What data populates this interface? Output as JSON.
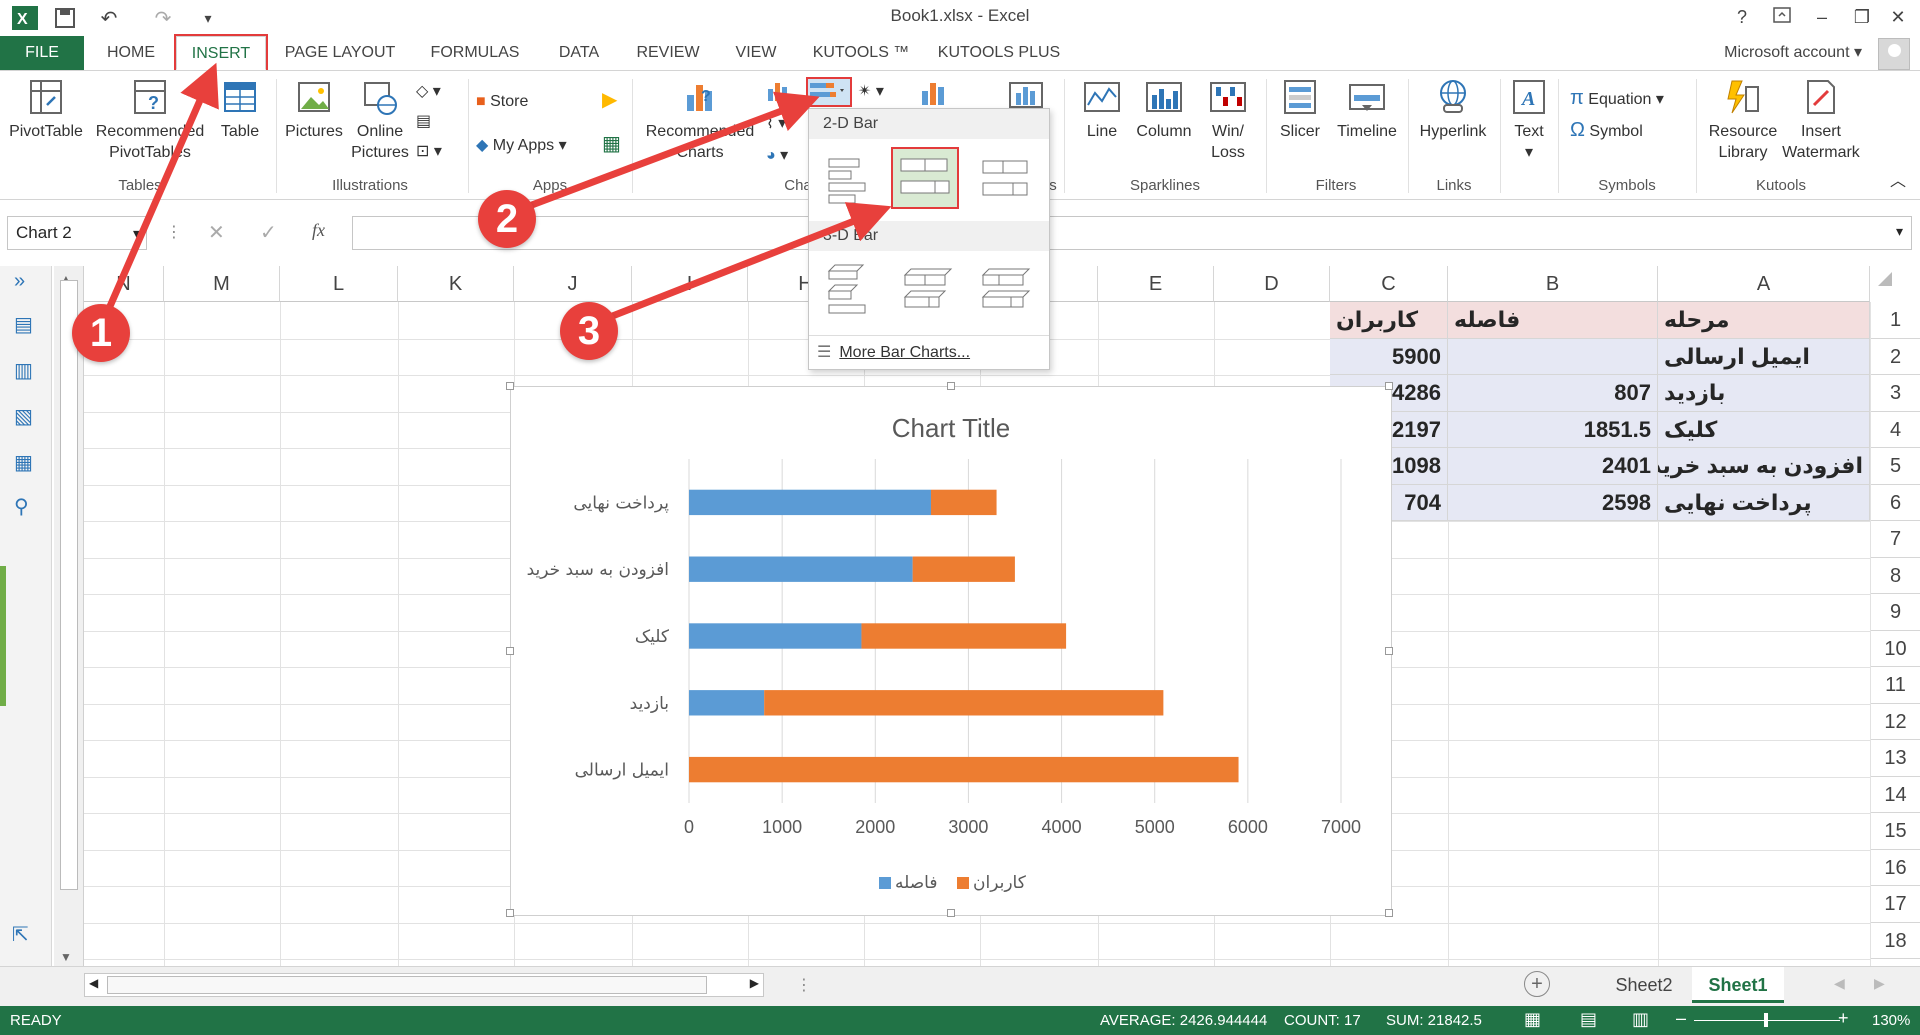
{
  "window": {
    "title": "Book1.xlsx - Excel",
    "help": "?",
    "quick_access": [
      "save-icon",
      "undo-icon",
      "redo-icon",
      "customize-icon"
    ]
  },
  "tabs": [
    "FILE",
    "HOME",
    "INSERT",
    "PAGE LAYOUT",
    "FORMULAS",
    "DATA",
    "REVIEW",
    "VIEW",
    "KUTOOLS ™",
    "KUTOOLS PLUS"
  ],
  "active_tab": "INSERT",
  "account": "Microsoft account",
  "ribbon": {
    "pivottable": "PivotTable",
    "recommended_pivot": [
      "Recommended",
      "PivotTables"
    ],
    "table": "Table",
    "pictures": "Pictures",
    "online_pictures": [
      "Online",
      "Pictures"
    ],
    "store": "Store",
    "my_apps": "My Apps",
    "recommended_charts": [
      "Recommended",
      "Charts"
    ],
    "line": "Line",
    "column": "Column",
    "winloss": [
      "Win/",
      "Loss"
    ],
    "slicer": "Slicer",
    "timeline": "Timeline",
    "hyperlink": "Hyperlink",
    "text": "Text",
    "equation": "Equation",
    "symbol": "Symbol",
    "resource_library": [
      "Resource",
      "Library"
    ],
    "insert_watermark": [
      "Insert",
      "Watermark"
    ],
    "groups": {
      "tables": "Tables",
      "illustrations": "Illustrations",
      "apps": "Apps",
      "charts": "Cha",
      "sparklines_tail": "s",
      "sparklines": "Sparklines",
      "filters": "Filters",
      "links": "Links",
      "symbols": "Symbols",
      "kutools": "Kutools"
    }
  },
  "formula_bar": {
    "name_box": "Chart 2",
    "fx": "fx",
    "cancel": "✕",
    "enter": "✓"
  },
  "dropdown": {
    "section_2d": "2-D Bar",
    "section_3d": "3-D Bar",
    "more": "More Bar Charts..."
  },
  "grid": {
    "columns": [
      "N",
      "M",
      "L",
      "K",
      "J",
      "I",
      "H",
      "G",
      "F",
      "E",
      "D",
      "C",
      "B",
      "A"
    ],
    "rows": [
      "1",
      "2",
      "3",
      "4",
      "5",
      "6",
      "7",
      "8",
      "9",
      "10",
      "11",
      "12",
      "13",
      "14",
      "15",
      "16",
      "17",
      "18"
    ],
    "header": {
      "A": "مرحله",
      "B": "فاصله",
      "C": "کاربران"
    },
    "data": [
      {
        "A": "ایمیل ارسالی",
        "B": "",
        "C": "5900"
      },
      {
        "A": "بازدید",
        "B": "807",
        "C": "4286"
      },
      {
        "A": "کلیک",
        "B": "1851.5",
        "C": "2197"
      },
      {
        "A": "افزودن به سبد خرید",
        "B": "2401",
        "C": "1098"
      },
      {
        "A": "پرداخت نهایی",
        "B": "2598",
        "C": "704"
      }
    ]
  },
  "chart_data": {
    "type": "bar",
    "orientation": "horizontal",
    "stacked": true,
    "title": "Chart Title",
    "categories": [
      "پرداخت نهایی",
      "افزودن به سبد خرید",
      "کلیک",
      "بازدید",
      "ایمیل ارسالی"
    ],
    "series": [
      {
        "name": "فاصله",
        "values": [
          2598,
          2401,
          1851.5,
          807,
          0
        ],
        "color": "#5b9bd5"
      },
      {
        "name": "کاربران",
        "values": [
          704,
          1098,
          2197,
          4286,
          5900
        ],
        "color": "#ed7d31"
      }
    ],
    "xlim": [
      0,
      7000
    ],
    "xticks": [
      "0",
      "1000",
      "2000",
      "3000",
      "4000",
      "5000",
      "6000",
      "7000"
    ],
    "grid": true,
    "legend": "bottom"
  },
  "sheets": [
    "Sheet2",
    "Sheet1"
  ],
  "active_sheet": "Sheet1",
  "status": {
    "ready": "READY",
    "average": "AVERAGE: 2426.944444",
    "count": "COUNT: 17",
    "sum": "SUM: 21842.5",
    "zoom": "130%"
  },
  "callouts": [
    "1",
    "2",
    "3"
  ],
  "colors": {
    "excel_green": "#217346",
    "callout_red": "#e8403c",
    "highlight_red": "#e33b3b"
  }
}
